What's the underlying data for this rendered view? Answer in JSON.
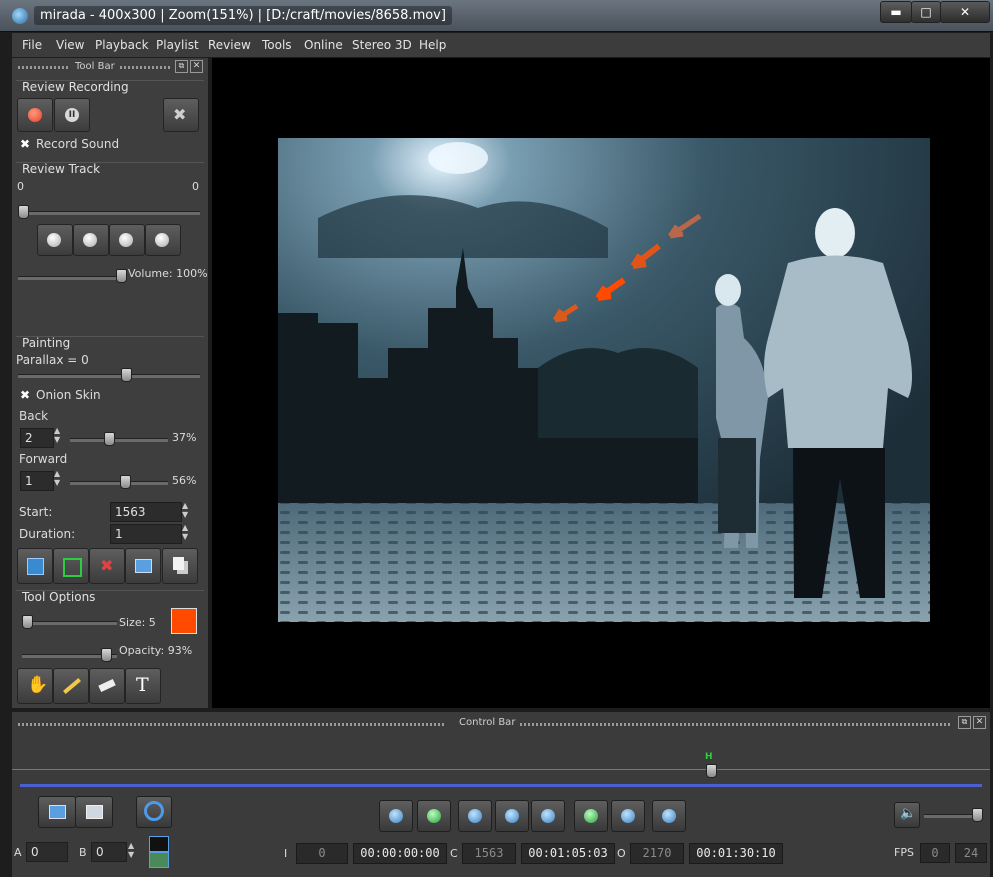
{
  "window": {
    "title": "mirada - 400x300 | Zoom(151%) | [D:/craft/movies/8658.mov]",
    "minimize": "▬",
    "maximize": "□",
    "close": "✕"
  },
  "menu": [
    "File",
    "View",
    "Playback",
    "Playlist",
    "Review",
    "Tools",
    "Online",
    "Stereo 3D",
    "Help"
  ],
  "toolbar": {
    "title": "Tool Bar",
    "review_recording": {
      "heading": "Review Recording",
      "record_sound_label": "Record Sound",
      "record_sound_checked": true
    },
    "review_track": {
      "heading": "Review Track",
      "start_value": "0",
      "end_value": "0",
      "volume_label": "Volume: 100%"
    },
    "painting": {
      "heading": "Painting",
      "parallax_label": "Parallax = 0",
      "onion_skin_label": "Onion Skin",
      "onion_skin_checked": true,
      "back_label": "Back",
      "back_value": "2",
      "back_percent": "37%",
      "forward_label": "Forward",
      "forward_value": "1",
      "forward_percent": "56%",
      "start_label": "Start:",
      "start_value": "1563",
      "duration_label": "Duration:",
      "duration_value": "1"
    },
    "tool_options": {
      "heading": "Tool Options",
      "size_label": "Size: 5",
      "opacity_label": "Opacity: 93%",
      "color": "#ff4a00",
      "text_tool_glyph": "T"
    }
  },
  "controlbar": {
    "title": "Control Bar",
    "a_label": "A",
    "a_value": "0",
    "b_label": "B",
    "b_value": "0",
    "i_label": "I",
    "i_value": "0",
    "i_timecode": "00:00:00:00",
    "c_label": "C",
    "c_value": "1563",
    "c_timecode": "00:01:05:03",
    "o_label": "O",
    "o_value": "2170",
    "o_timecode": "00:01:30:10",
    "fps_label": "FPS",
    "fps_actual": "0",
    "fps_target": "24",
    "timeline_marker": "H"
  },
  "colors": {
    "accent_blue": "#4a5fd0",
    "record_red": "#e8402a",
    "paint_orange": "#ff4a00"
  }
}
